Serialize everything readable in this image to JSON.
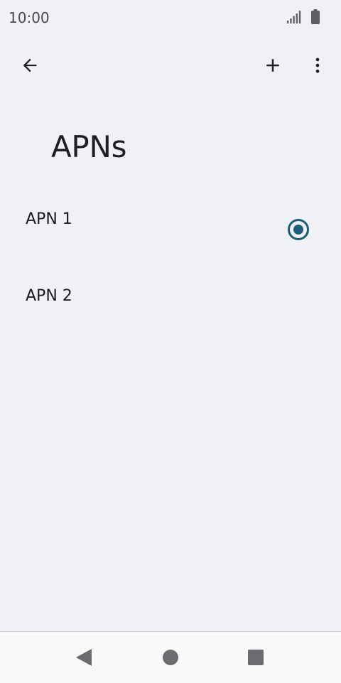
{
  "status_bar": {
    "time": "10:00",
    "icons": [
      "signal-icon",
      "battery-icon"
    ]
  },
  "toolbar": {
    "back_icon": "arrow-back-icon",
    "add_icon": "add-icon",
    "more_icon": "more-vert-icon"
  },
  "page": {
    "title": "APNs"
  },
  "apns": [
    {
      "name": "APN 1",
      "selected": true
    },
    {
      "name": "APN 2",
      "selected": false
    }
  ],
  "colors": {
    "accent": "#1d5f7a",
    "background": "#eff1f4",
    "nav_background": "#f9f9fa"
  },
  "nav_bar": {
    "icons": [
      "nav-back-icon",
      "nav-home-icon",
      "nav-recents-icon"
    ]
  }
}
